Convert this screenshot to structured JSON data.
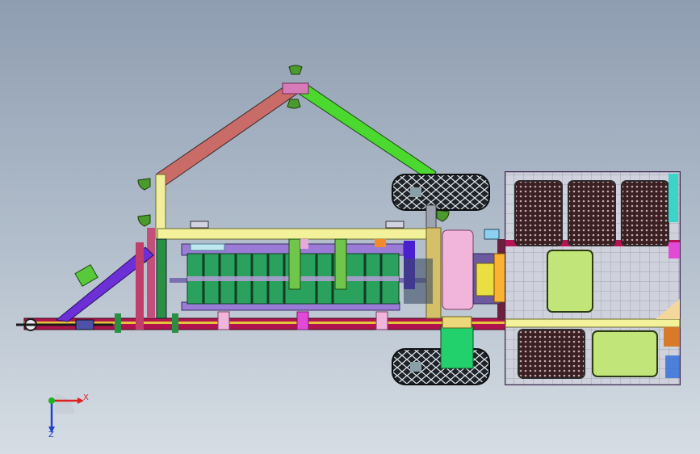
{
  "viewport": {
    "background_top": "#8f9db1",
    "background_bottom": "#d6dde4"
  },
  "triad": {
    "x_label": "X",
    "z_label": "Z",
    "x_color": "#e02020",
    "y_color": "#20b020",
    "z_color": "#2040d0"
  },
  "model": {
    "tire_icon": "tire-icon",
    "light_icon": "light-icon",
    "colors": {
      "frame": "#b0134f",
      "boom_left": "#c96b67",
      "boom_right": "#4bd82f",
      "rail": "#f3f29a",
      "drum": "#2aa15c",
      "pulley": "#f1b5dc",
      "gearbox": "#f9b232",
      "chute": "#22d16b",
      "cab": "#dfe4ee",
      "panel": "#c2e57a",
      "lamp": "#4a9a2c"
    }
  }
}
